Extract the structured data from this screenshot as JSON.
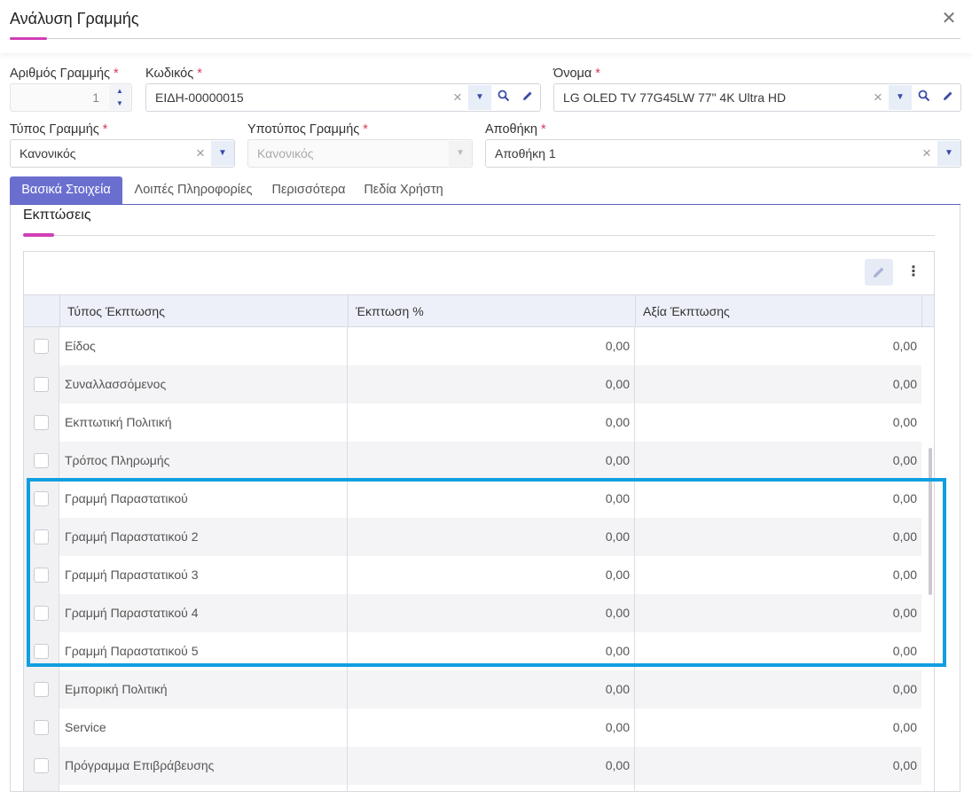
{
  "window": {
    "title": "Ανάλυση Γραμμής",
    "close_glyph": "✕"
  },
  "form": {
    "line_number": {
      "label": "Αριθμός Γραμμής",
      "required": "*",
      "value": "1"
    },
    "code": {
      "label": "Κωδικός",
      "required": "*",
      "value": "ΕΙΔΗ-00000015"
    },
    "name": {
      "label": "Όνομα",
      "required": "*",
      "value": "LG OLED TV 77G45LW 77\" 4K Ultra HD"
    },
    "line_type": {
      "label": "Τύπος Γραμμής",
      "required": "*",
      "value": "Κανονικός"
    },
    "line_subtype": {
      "label": "Υποτύπος Γραμμής",
      "required": "*",
      "value": "Κανονικός"
    },
    "warehouse": {
      "label": "Αποθήκη",
      "required": "*",
      "value": "Αποθήκη 1"
    }
  },
  "tabs": [
    {
      "label": "Βασικά Στοιχεία",
      "active": true
    },
    {
      "label": "Λοιπές Πληροφορίες",
      "active": false
    },
    {
      "label": "Περισσότερα",
      "active": false
    },
    {
      "label": "Πεδία Χρήστη",
      "active": false
    }
  ],
  "section": {
    "title": "Εκπτώσεις"
  },
  "grid": {
    "columns": [
      "Τύπος Έκπτωσης",
      "Έκπτωση %",
      "Αξία Έκπτωσης"
    ],
    "rows": [
      {
        "type": "Είδος",
        "percent": "0,00",
        "amount": "0,00"
      },
      {
        "type": "Συναλλασσόμενος",
        "percent": "0,00",
        "amount": "0,00"
      },
      {
        "type": "Εκπτωτική Πολιτική",
        "percent": "0,00",
        "amount": "0,00"
      },
      {
        "type": "Τρόπος Πληρωμής",
        "percent": "0,00",
        "amount": "0,00"
      },
      {
        "type": "Γραμμή Παραστατικού",
        "percent": "0,00",
        "amount": "0,00"
      },
      {
        "type": "Γραμμή Παραστατικού 2",
        "percent": "0,00",
        "amount": "0,00"
      },
      {
        "type": "Γραμμή Παραστατικού 3",
        "percent": "0,00",
        "amount": "0,00"
      },
      {
        "type": "Γραμμή Παραστατικού 4",
        "percent": "0,00",
        "amount": "0,00"
      },
      {
        "type": "Γραμμή Παραστατικού 5",
        "percent": "0,00",
        "amount": "0,00"
      },
      {
        "type": "Εμπορική Πολιτική",
        "percent": "0,00",
        "amount": "0,00"
      },
      {
        "type": "Service",
        "percent": "0,00",
        "amount": "0,00"
      },
      {
        "type": "Πρόγραμμα Επιβράβευσης",
        "percent": "0,00",
        "amount": "0,00"
      }
    ],
    "more_glyph": "⋮"
  },
  "colors": {
    "accent_pink": "#d13fb5",
    "tab_active": "#6a6fcf",
    "highlight_border": "#119fe0",
    "icon_blue": "#3a4ba8"
  }
}
